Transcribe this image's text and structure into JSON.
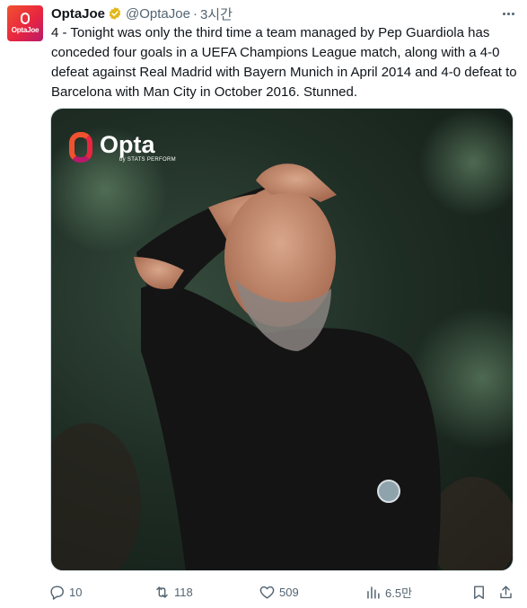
{
  "author": {
    "display_name": "OptaJoe",
    "handle": "@OptaJoe",
    "time": "3시간",
    "separator": "·",
    "avatar_label": "OptaJoe"
  },
  "tweet": {
    "text": "4 - Tonight was only the third time a team managed by Pep Guardiola has conceded four goals in a UEFA Champions League match, along with a 4-0 defeat against Real Madrid with Bayern Munich in April 2014 and 4-0 defeat to Barcelona with Man City in October 2016. Stunned."
  },
  "media": {
    "brand_name": "Opta",
    "brand_sub": "by STATS PERFORM"
  },
  "actions": {
    "replies": "10",
    "retweets": "118",
    "likes": "509",
    "views": "6.5만"
  },
  "colors": {
    "text": "#0f1419",
    "secondary": "#536471",
    "verified_gold": "#e2b719",
    "brand_orange": "#f0522f",
    "brand_red": "#e8263f"
  },
  "icons": [
    "verified-badge-icon",
    "more-icon",
    "reply-icon",
    "retweet-icon",
    "like-icon",
    "views-icon",
    "bookmark-icon",
    "share-icon"
  ]
}
